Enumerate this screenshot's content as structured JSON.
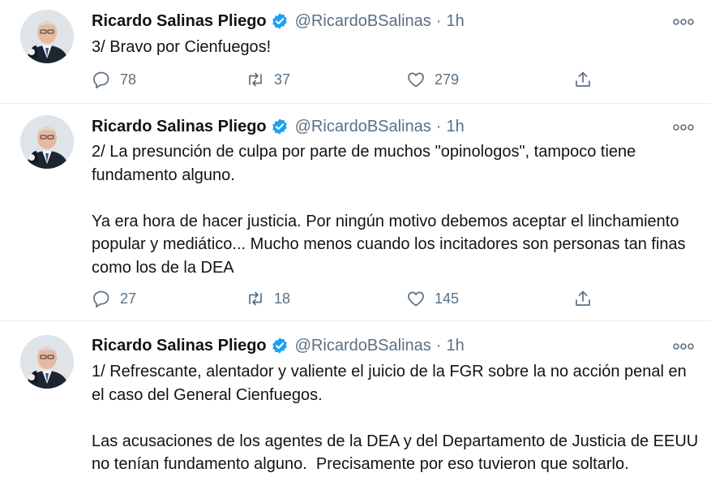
{
  "tweets": [
    {
      "name": "Ricardo Salinas Pliego",
      "handle": "@RicardoBSalinas",
      "separator": "·",
      "time": "1h",
      "text": "3/ Bravo por Cienfuegos!",
      "replies": "78",
      "retweets": "37",
      "likes": "279"
    },
    {
      "name": "Ricardo Salinas Pliego",
      "handle": "@RicardoBSalinas",
      "separator": "·",
      "time": "1h",
      "text": "2/ La presunción de culpa por parte de muchos \"opinologos\", tampoco tiene fundamento alguno.\n\nYa era hora de hacer justicia. Por ningún motivo debemos aceptar el linchamiento popular y mediático... Mucho menos cuando los incitadores son personas tan finas como los de la DEA",
      "replies": "27",
      "retweets": "18",
      "likes": "145"
    },
    {
      "name": "Ricardo Salinas Pliego",
      "handle": "@RicardoBSalinas",
      "separator": "·",
      "time": "1h",
      "text": "1/ Refrescante, alentador y valiente el juicio de la FGR sobre la no acción penal en el caso del General Cienfuegos.\n\nLas acusaciones de los agentes de la DEA y del Departamento de Justicia de EEUU no tenían fundamento alguno.  Precisamente por eso tuvieron que soltarlo."
    }
  ],
  "icons": {
    "reply": "reply-icon",
    "retweet": "retweet-icon",
    "like": "heart-icon",
    "share": "share-icon",
    "more": "more-icon",
    "verified": "verified-badge-icon"
  },
  "colors": {
    "text": "#0f1419",
    "secondary": "#5b7083",
    "verified": "#1da1f2",
    "divider": "#e6ecf0"
  }
}
